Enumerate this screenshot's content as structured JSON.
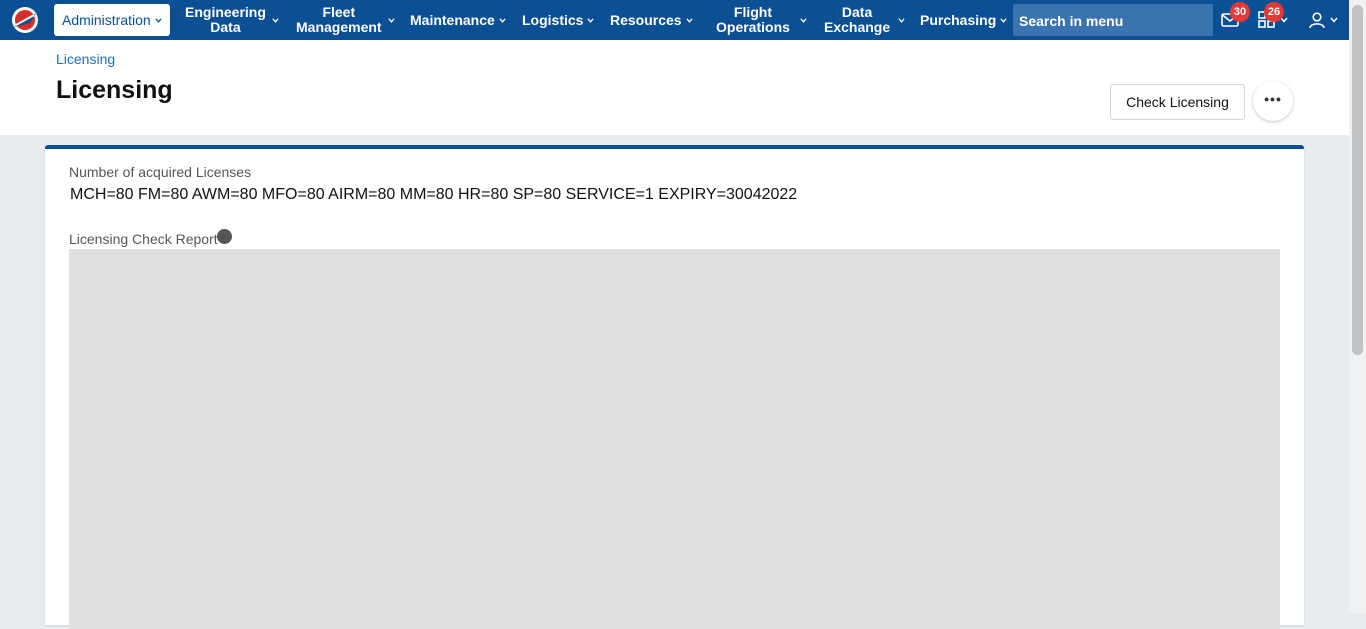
{
  "nav": {
    "items": [
      {
        "label": "Administration",
        "active": true
      },
      {
        "label": "Engineering\nData"
      },
      {
        "label": "Fleet\nManagement"
      },
      {
        "label": "Maintenance"
      },
      {
        "label": "Logistics"
      },
      {
        "label": "Resources"
      },
      {
        "label": "Flight\nOperations"
      },
      {
        "label": "Data\nExchange"
      },
      {
        "label": "Purchasing"
      }
    ],
    "search_placeholder": "Search in menu",
    "mail_count": "30",
    "apps_count": "26",
    "icons": [
      "logo",
      "mail-icon",
      "apps-icon",
      "user-icon"
    ]
  },
  "header": {
    "breadcrumb": "Licensing",
    "title": "Licensing",
    "check_button": "Check Licensing",
    "more_button": "•••"
  },
  "card": {
    "licenses_label": "Number of acquired Licenses",
    "licenses_value": "MCH=80 FM=80 AWM=80 MFO=80 AIRM=80 MM=80 HR=80 SP=80 SERVICE=1 EXPIRY=30042022",
    "report_label": "Licensing Check Report"
  },
  "colors": {
    "accent": "#0b4f94",
    "badge": "#e53935",
    "link": "#1a73c9"
  }
}
